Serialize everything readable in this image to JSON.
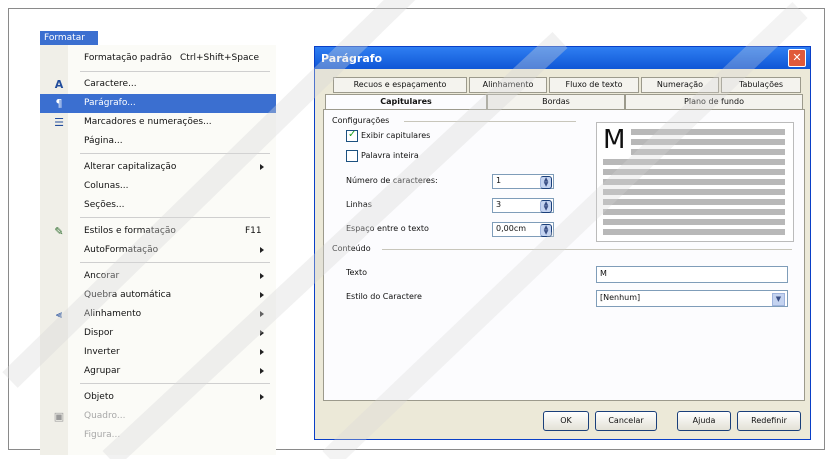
{
  "menubar": {
    "format_label": "Formatar"
  },
  "menu": {
    "items": [
      {
        "label": "Formatação padrão",
        "shortcut": "Ctrl+Shift+Space",
        "icon": ""
      },
      {
        "label": "Caractere...",
        "icon": "font-icon"
      },
      {
        "label": "Parágrafo...",
        "icon": "paragraph-icon",
        "selected": true
      },
      {
        "label": "Marcadores e numerações...",
        "icon": "list-icon"
      },
      {
        "label": "Página...",
        "icon": ""
      },
      {
        "label": "Alterar capitalização",
        "submenu": true
      },
      {
        "label": "Colunas..."
      },
      {
        "label": "Seções..."
      },
      {
        "label": "Estilos e formatação",
        "shortcut": "F11",
        "icon": "styles-icon"
      },
      {
        "label": "AutoFormatação",
        "submenu": true
      },
      {
        "label": "Ancorar",
        "submenu": true
      },
      {
        "label": "Quebra automática",
        "submenu": true
      },
      {
        "label": "Alinhamento",
        "submenu": true,
        "icon": "align-icon"
      },
      {
        "label": "Dispor",
        "submenu": true
      },
      {
        "label": "Inverter",
        "submenu": true
      },
      {
        "label": "Agrupar",
        "submenu": true
      },
      {
        "label": "Objeto",
        "submenu": true
      },
      {
        "label": "Quadro...",
        "disabled": true,
        "icon": "frame-icon"
      },
      {
        "label": "Figura...",
        "disabled": true
      }
    ]
  },
  "dialog": {
    "title": "Parágrafo",
    "tabs_row1": [
      "Recuos e espaçamento",
      "Alinhamento",
      "Fluxo de texto",
      "Numeração",
      "Tabulações"
    ],
    "tabs_row2": [
      "Capitulares",
      "Bordas",
      "Plano de fundo"
    ],
    "config_heading": "Configurações",
    "show_dropcaps": "Exibir capitulares",
    "whole_word": "Palavra inteira",
    "num_chars_label": "Número de caracteres:",
    "num_chars_value": "1",
    "lines_label": "Linhas",
    "lines_value": "3",
    "spacing_label": "Espaço entre o texto",
    "spacing_value": "0,00cm",
    "content_heading": "Conteúdo",
    "text_label": "Texto",
    "text_value": "M",
    "char_style_label": "Estilo do Caractere",
    "char_style_value": "[Nenhum]",
    "preview_letter": "M",
    "buttons": {
      "ok": "OK",
      "cancel": "Cancelar",
      "help": "Ajuda",
      "reset": "Redefinir"
    }
  },
  "colors": {
    "selection": "#3b6fd0",
    "titlebar": "#0f56d6",
    "dialog_bg": "#ece9d8"
  }
}
